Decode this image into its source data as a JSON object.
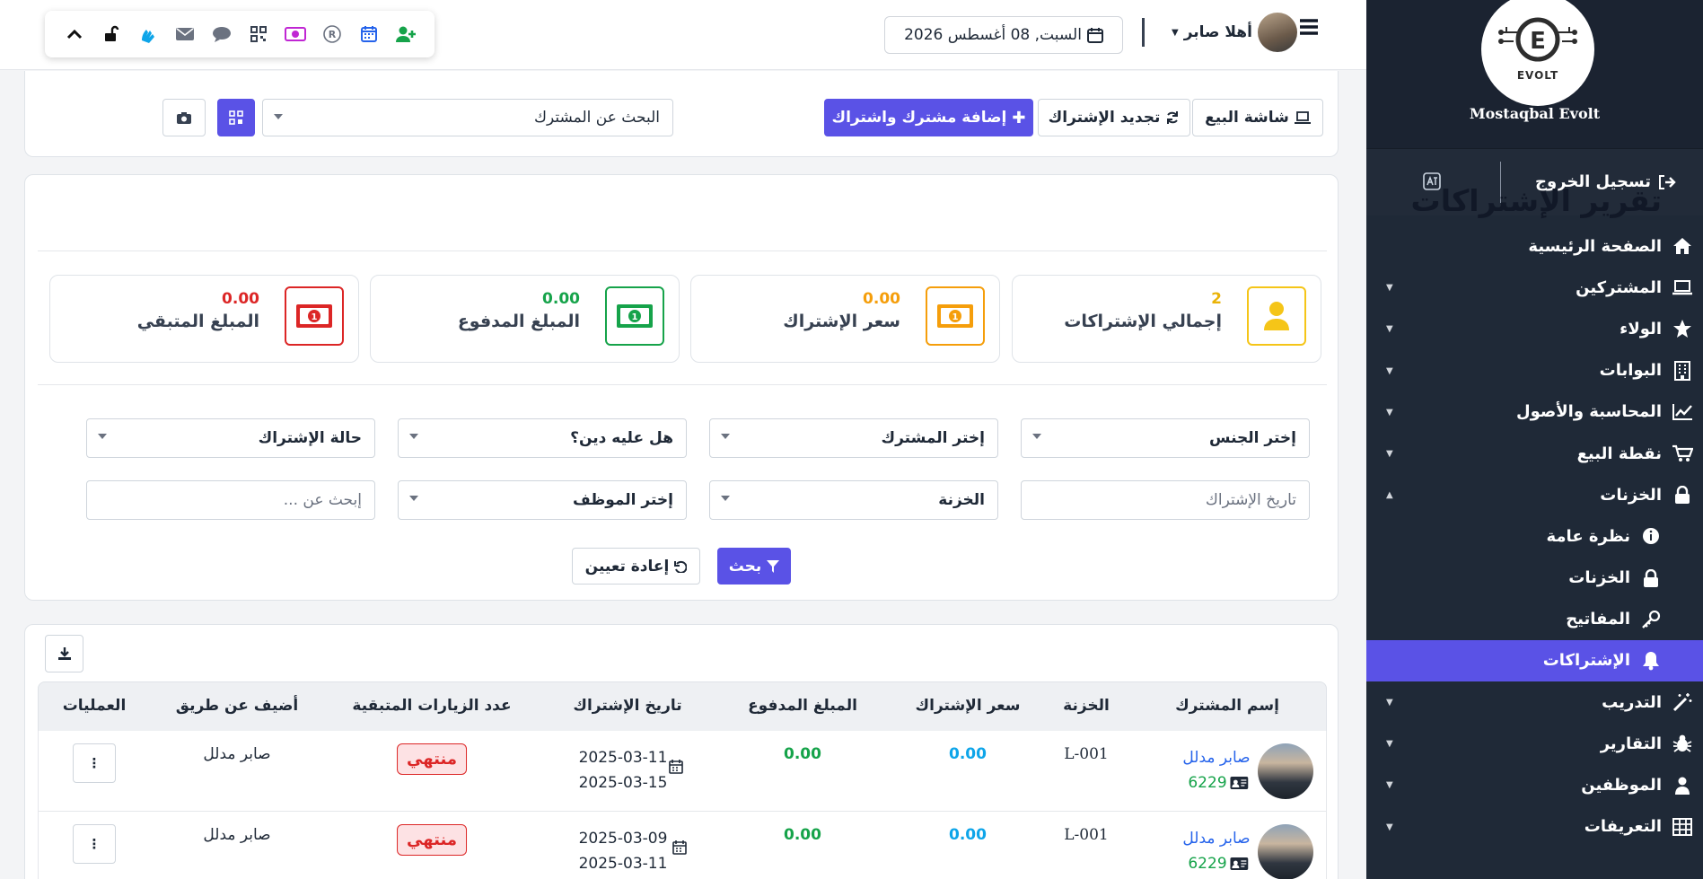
{
  "colors": {
    "accent": "#5a52e6",
    "sidebar": "#1f2937",
    "success": "#16a34a",
    "warning": "#f59e0b",
    "danger": "#dc2626",
    "info": "#0ea5e9"
  },
  "brand": {
    "name": "Mostaqbal Evolt",
    "logo_text": "EVOLT"
  },
  "sidebar": {
    "logout": "تسجيل الخروج",
    "items": [
      {
        "label": "الصفحة الرئيسية",
        "icon": "home-icon",
        "chevron": ""
      },
      {
        "label": "المشتركين",
        "icon": "laptop-icon",
        "chevron": "▼"
      },
      {
        "label": "الولاء",
        "icon": "star-icon",
        "chevron": "▼"
      },
      {
        "label": "البوابات",
        "icon": "building-icon",
        "chevron": "▼"
      },
      {
        "label": "المحاسبة والأصول",
        "icon": "chart-line-icon",
        "chevron": "▼"
      },
      {
        "label": "نقطة البيع",
        "icon": "cart-icon",
        "chevron": "▼"
      },
      {
        "label": "الخزنات",
        "icon": "lock-icon",
        "chevron": "▲"
      },
      {
        "label": "نظرة عامة",
        "icon": "info-icon",
        "chevron": ""
      },
      {
        "label": "الخزنات",
        "icon": "lock-icon",
        "chevron": ""
      },
      {
        "label": "المفاتيح",
        "icon": "key-icon",
        "chevron": ""
      },
      {
        "label": "الإشتراكات",
        "icon": "bell-icon",
        "chevron": ""
      },
      {
        "label": "التدريب",
        "icon": "wand-icon",
        "chevron": "▼"
      },
      {
        "label": "التقارير",
        "icon": "bug-icon",
        "chevron": "▼"
      },
      {
        "label": "الموظفين",
        "icon": "user-icon",
        "chevron": "▼"
      },
      {
        "label": "التعريفات",
        "icon": "table-icon",
        "chevron": "▼"
      }
    ]
  },
  "header": {
    "greeting": "أهلا صابر",
    "date": "السبت, 08 أغسطس 2026"
  },
  "toolbar": {
    "pos_screen": "شاشة البيع",
    "renew": "تجديد الإشتراك",
    "add_subscriber": "إضافة مشترك واشتراك",
    "search_placeholder": "البحث عن المشترك"
  },
  "page": {
    "title": "تقرير الإشتراكات"
  },
  "stats": [
    {
      "label": "إجمالي الإشتراكات",
      "value": "2"
    },
    {
      "label": "سعر الإشتراك",
      "value": "0.00"
    },
    {
      "label": "المبلغ المدفوع",
      "value": "0.00"
    },
    {
      "label": "المبلغ المتبقي",
      "value": "0.00"
    }
  ],
  "filters": {
    "gender": "إختر الجنس",
    "subscriber": "إختر المشترك",
    "debt": "هل عليه دين؟",
    "status": "حالة الإشتراك",
    "date_placeholder": "تاريخ الإشتراك",
    "treasury": "الخزنة",
    "employee": "إختر الموظف",
    "search_placeholder": "إبحث عن ...",
    "search_btn": "بحث",
    "reset_btn": "إعادة تعيين"
  },
  "table": {
    "headers": [
      "إسم المشترك",
      "الخزنة",
      "سعر الإشتراك",
      "المبلغ المدفوع",
      "تاريخ الإشتراك",
      "عدد الزيارات المتبقية",
      "أضيف عن طريق",
      "العمليات"
    ],
    "rows": [
      {
        "name": "صابر مدلل",
        "code": "6229",
        "treasury": "L-001",
        "price": "0.00",
        "paid": "0.00",
        "date_from": "2025-03-11",
        "date_to": "2025-03-15",
        "visits": "منتهي",
        "added_by": "صابر مدلل",
        "ops": "⋮"
      },
      {
        "name": "صابر مدلل",
        "code": "6229",
        "treasury": "L-001",
        "price": "0.00",
        "paid": "0.00",
        "date_from": "2025-03-09",
        "date_to": "2025-03-11",
        "visits": "منتهي",
        "added_by": "صابر مدلل",
        "ops": "⋮"
      }
    ]
  }
}
